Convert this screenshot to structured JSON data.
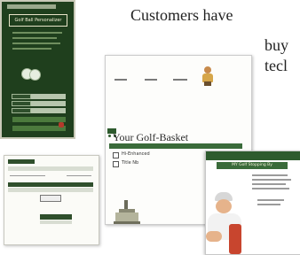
{
  "caption": {
    "line1": "Customers have",
    "line2": "buy",
    "line3": "tecl"
  },
  "left_panel": {
    "banner": "Golf Ball Personalizer"
  },
  "basket": {
    "title": "Your Golf-Basket",
    "items": [
      "Hi-Enhanced",
      "Title Nb"
    ]
  },
  "right_page": {
    "subtitle": "MY Golf Stopping By"
  },
  "colors": {
    "panel_green": "#1f3f1d",
    "header_green": "#2e5b2e",
    "bag_red": "#c8452e"
  }
}
